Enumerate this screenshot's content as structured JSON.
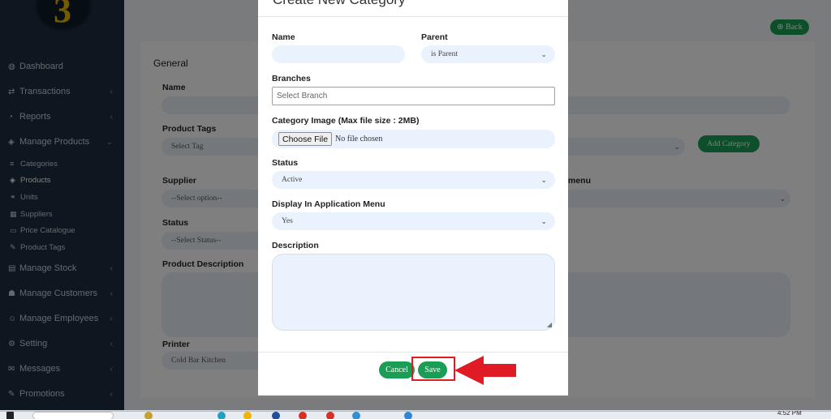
{
  "sidebar": {
    "logo_text": "3",
    "items": [
      {
        "label": "Dashboard",
        "icon": "dashboard-icon",
        "glyph": "◍"
      },
      {
        "label": "Transactions",
        "icon": "exchange-icon",
        "glyph": "⇄",
        "chevron": "‹"
      },
      {
        "label": "Reports",
        "icon": "pie-chart-icon",
        "glyph": "◔",
        "chevron": "‹"
      },
      {
        "label": "Manage Products",
        "icon": "tag-icon",
        "glyph": "◈",
        "chevron": "⌄"
      }
    ],
    "sub_items": [
      {
        "label": "Categories",
        "glyph": "≡"
      },
      {
        "label": "Products",
        "glyph": "◈"
      },
      {
        "label": "Units",
        "glyph": "⚭"
      },
      {
        "label": "Suppliers",
        "glyph": "▦"
      },
      {
        "label": "Price Catalogue",
        "glyph": "▭"
      },
      {
        "label": "Product Tags",
        "glyph": "✎"
      }
    ],
    "items_after": [
      {
        "label": "Manage Stock",
        "glyph": "▤",
        "chevron": "‹"
      },
      {
        "label": "Manage Customers",
        "glyph": "☗",
        "chevron": "‹"
      },
      {
        "label": "Manage Employees",
        "glyph": "☺",
        "chevron": "‹"
      },
      {
        "label": "Setting",
        "glyph": "⚙",
        "chevron": "‹"
      },
      {
        "label": "Messages",
        "glyph": "✉",
        "chevron": "‹"
      },
      {
        "label": "Promotions",
        "glyph": "✎",
        "chevron": "‹"
      }
    ]
  },
  "page": {
    "back_label": "⊕ Back",
    "section_title": "General",
    "name_label": "Name",
    "product_tags_label": "Product Tags",
    "product_tags_placeholder": "Select Tag",
    "add_category_label": "Add Category",
    "supplier_label": "Supplier",
    "supplier_value": "--Select option--",
    "menu_label_fragment": "menu",
    "status_label": "Status",
    "status_value": "--Select Status--",
    "description_label": "Product Description",
    "printer_label": "Printer",
    "printer_value": "Cold Bar Kitchen"
  },
  "modal": {
    "title": "Create New Category",
    "name_label": "Name",
    "parent_label": "Parent",
    "parent_value": "is Parent",
    "branches_label": "Branches",
    "branches_placeholder": "Select Branch",
    "image_label": "Category Image (Max file size : 2MB)",
    "choose_file_label": "Choose File",
    "no_file_label": "No file chosen",
    "status_label": "Status",
    "status_value": "Active",
    "menu_label": "Display In Application Menu",
    "menu_value": "Yes",
    "description_label": "Description",
    "cancel_label": "Cancel",
    "save_label": "Save"
  },
  "taskbar": {
    "time": "4:52 PM"
  },
  "colors": {
    "sidebar": "#1c2d3f",
    "accent_green": "#1a9e55",
    "highlight_red": "#e01b24"
  }
}
